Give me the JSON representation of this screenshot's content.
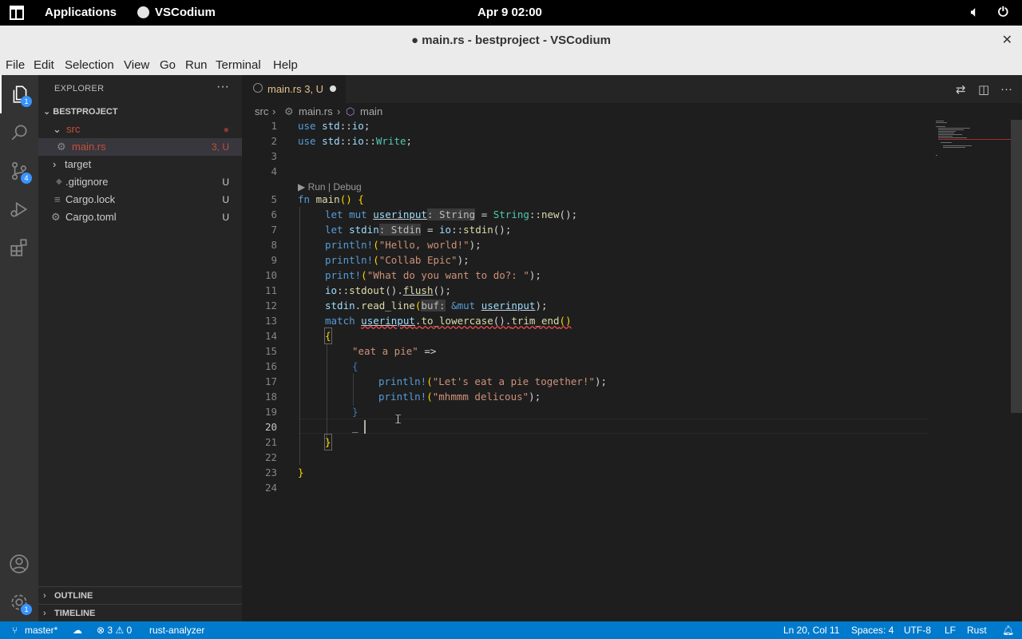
{
  "topbar": {
    "apps_label": "Applications",
    "app_label": "VSCodium",
    "clock": "Apr 9  02:00",
    "volume_icon": "speaker-icon",
    "power_icon": "power-icon"
  },
  "window": {
    "title": "● main.rs - bestproject - VSCodium",
    "close": "✕"
  },
  "menu": [
    "File",
    "Edit",
    "Selection",
    "View",
    "Go",
    "Run",
    "Terminal",
    "Help"
  ],
  "activity": {
    "explorer_badge": "1",
    "scm_badge": "4",
    "settings_badge": "1"
  },
  "sidebar": {
    "header": "EXPLORER",
    "more": "···",
    "project": "BESTPROJECT",
    "items": [
      {
        "label": "src",
        "status": "●",
        "color": "#c74e39"
      },
      {
        "label": "main.rs",
        "status": "3, U",
        "color": "#c74e39"
      },
      {
        "label": "target",
        "status": "",
        "color": "#cccccc"
      },
      {
        "label": ".gitignore",
        "status": "U",
        "color": "#cccccc"
      },
      {
        "label": "Cargo.lock",
        "status": "U",
        "color": "#cccccc"
      },
      {
        "label": "Cargo.toml",
        "status": "U",
        "color": "#cccccc"
      }
    ],
    "outline": "OUTLINE",
    "timeline": "TIMELINE"
  },
  "tab": {
    "label": "main.rs  3, U"
  },
  "breadcrumb": {
    "folder": "src",
    "file": "main.rs",
    "symbol": "main"
  },
  "codelens": "▶ Run | Debug",
  "line_numbers": [
    "1",
    "2",
    "3",
    "4",
    "5",
    "6",
    "7",
    "8",
    "9",
    "10",
    "11",
    "12",
    "13",
    "14",
    "15",
    "16",
    "17",
    "18",
    "19",
    "20",
    "21",
    "22",
    "23",
    "24"
  ],
  "code": {
    "l1a": "use",
    "l1b": " std",
    "l1c": "::",
    "l1d": "io",
    "l1e": ";",
    "l2a": "use",
    "l2b": " std",
    "l2c": "::",
    "l2d": "io",
    "l2e": "::",
    "l2f": "Write",
    "l2g": ";",
    "l5a": "fn",
    "l5b": " main",
    "l5c": "()",
    "l5d": " {",
    "l6a": "let mut",
    "l6b": "userinput",
    "l6c": ": String",
    "l6d": " = ",
    "l6e": "String",
    "l6f": "::",
    "l6g": "new",
    "l6h": "();",
    "l7a": "let",
    "l7b": "stdin",
    "l7c": ": Stdin",
    "l7d": " = ",
    "l7e": "io",
    "l7f": "::",
    "l7g": "stdin",
    "l7h": "();",
    "l8a": "println!",
    "l8b": "(",
    "l8c": "\"Hello, world!\"",
    "l8d": ");",
    "l9a": "println!",
    "l9b": "(",
    "l9c": "\"Collab Epic\"",
    "l9d": ");",
    "l10a": "print!",
    "l10b": "(",
    "l10c": "\"What do you want to do?: \"",
    "l10d": ");",
    "l11a": "io",
    "l11b": "::",
    "l11c": "stdout",
    "l11d": "().",
    "l11e": "flush",
    "l11f": "();",
    "l12a": "stdin",
    "l12b": ".",
    "l12c": "read_line",
    "l12d": "(",
    "l12e": "buf:",
    "l12f": " &mut ",
    "l12g": "userinput",
    "l12h": ");",
    "l13a": "match",
    "l13b": "userinput",
    "l13c": ".",
    "l13d": "to_lowercase",
    "l13e": "().",
    "l13f": "trim_end",
    "l13g": "()",
    "l14": "{",
    "l15a": "\"eat a pie\"",
    "l15b": " =>",
    "l16": "{",
    "l17a": "println!",
    "l17b": "(",
    "l17c": "\"Let's eat a pie together!\"",
    "l17d": ");",
    "l18a": "println!",
    "l18b": "(",
    "l18c": "\"mhmmm delicous\"",
    "l18d": ");",
    "l19": "}",
    "l20": "_",
    "l21": "}",
    "l23": "}"
  },
  "statusbar": {
    "branch": "master*",
    "sync_icon": "sync-icon",
    "problems": "⊗ 3 ⚠ 0",
    "server": "rust-analyzer",
    "position": "Ln 20, Col 11",
    "spaces": "Spaces: 4",
    "encoding": "UTF-8",
    "eol": "LF",
    "language": "Rust",
    "bell_icon": "bell-icon"
  }
}
